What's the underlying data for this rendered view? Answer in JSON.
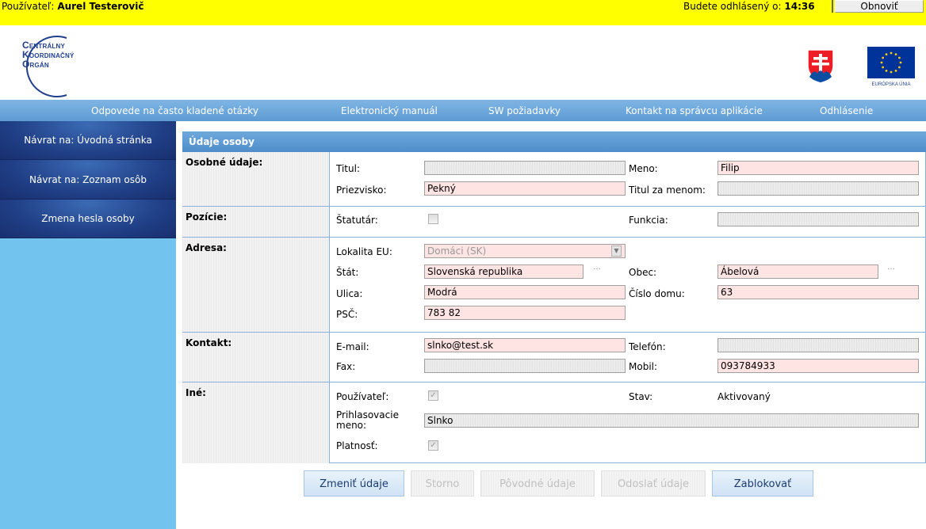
{
  "topbar": {
    "user_label": "Používateľ:",
    "user_name": "Aurel Testerovič",
    "logout_label": "Budete odhlásený o:",
    "logout_time": "14:36",
    "refresh_label": "Obnoviť"
  },
  "logo": {
    "line1": "Centrálny",
    "line2": "Koordinačný",
    "line3": "Orgán",
    "eu_caption": "EURÓPSKA ÚNIA"
  },
  "nav": {
    "faq": "Odpovede na často kladené otázky",
    "manual": "Elektronický manuál",
    "sw": "SW požiadavky",
    "contact": "Kontakt na správcu aplikácie",
    "logout": "Odhlásenie"
  },
  "sidebar": {
    "items": [
      {
        "label": "Návrat na: Úvodná stránka"
      },
      {
        "label": "Návrat na: Zoznam osôb"
      },
      {
        "label": "Zmena hesla osoby"
      }
    ]
  },
  "panel": {
    "title": "Údaje osoby"
  },
  "personal": {
    "section": "Osobné údaje:",
    "title_label": "Titul:",
    "title_value": "",
    "name_label": "Meno:",
    "name_value": "Filip",
    "surname_label": "Priezvisko:",
    "surname_value": "Pekný",
    "title_after_label": "Titul za menom:",
    "title_after_value": ""
  },
  "position": {
    "section": "Pozície:",
    "statutory_label": "Štatutár:",
    "statutory_checked": false,
    "function_label": "Funkcia:",
    "function_value": ""
  },
  "address": {
    "section": "Adresa:",
    "locality_label": "Lokalita EU:",
    "locality_value": "Domáci (SK)",
    "state_label": "Štát:",
    "state_value": "Slovenská republika",
    "municipality_label": "Obec:",
    "municipality_value": "Ábelová",
    "street_label": "Ulica:",
    "street_value": "Modrá",
    "house_label": "Číslo domu:",
    "house_value": "63",
    "zip_label": "PSČ:",
    "zip_value": "783 82"
  },
  "contact": {
    "section": "Kontakt:",
    "email_label": "E-mail:",
    "email_value": "slnko@test.sk",
    "phone_label": "Telefón:",
    "phone_value": "",
    "fax_label": "Fax:",
    "fax_value": "",
    "mobile_label": "Mobil:",
    "mobile_value": "093784933"
  },
  "other": {
    "section": "Iné:",
    "user_label": "Používateľ:",
    "user_checked": true,
    "status_label": "Stav:",
    "status_value": "Aktivovaný",
    "login_label_1": "Prihlasovacie",
    "login_label_2": "meno:",
    "login_value": "Slnko",
    "validity_label": "Platnosť:",
    "validity_checked": true
  },
  "buttons": {
    "change": "Zmeniť údaje",
    "cancel": "Storno",
    "original": "Pôvodné údaje",
    "send": "Odoslať údaje",
    "block": "Zablokovať"
  },
  "colors": {
    "topbar_bg": "#ffff00",
    "nav_bg": "#5e9bd3",
    "sidebar_bg": "#72c4ef",
    "sidebar_item_bg": "#203f86",
    "required_field_bg": "#ffe4e4",
    "brand_blue": "#1f3f8f"
  }
}
